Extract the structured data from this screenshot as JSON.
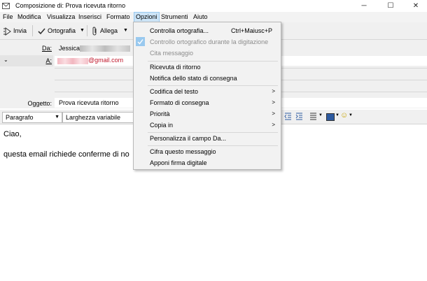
{
  "window": {
    "title": "Composizione di: Prova ricevuta ritorno",
    "min": "─",
    "max": "☐",
    "close": "✕"
  },
  "menubar": {
    "items": [
      {
        "label": "File"
      },
      {
        "label": "Modifica"
      },
      {
        "label": "Visualizza"
      },
      {
        "label": "Inserisci"
      },
      {
        "label": "Formato"
      },
      {
        "label": "Opzioni"
      },
      {
        "label": "Strumenti"
      },
      {
        "label": "Aiuto"
      }
    ]
  },
  "toolbar": {
    "send_label": "Invia",
    "spelling_label": "Ortografia",
    "attach_label": "Allega"
  },
  "header": {
    "from_label": "Da:",
    "from_name": "Jessica",
    "to_label": "A:",
    "to_domain": "@gmail.com",
    "subject_label": "Oggetto:",
    "subject_value": "Prova ricevuta ritorno"
  },
  "format": {
    "paragraph": "Paragrafo",
    "font": "Larghezza variabile"
  },
  "body": {
    "line1": "Ciao,",
    "line2": "questa email richiede conferme di no"
  },
  "options_menu": {
    "items": [
      {
        "label": "Controlla ortografia...",
        "shortcut": "Ctrl+Maiusc+P"
      },
      {
        "label": "Controllo ortografico durante la digitazione"
      },
      {
        "label": "Cita messaggio"
      },
      {
        "label": "Ricevuta di ritorno"
      },
      {
        "label": "Notifica dello stato di consegna"
      },
      {
        "label": "Codifica del testo"
      },
      {
        "label": "Formato di consegna"
      },
      {
        "label": "Priorità"
      },
      {
        "label": "Copia in"
      },
      {
        "label": "Personalizza il campo Da..."
      },
      {
        "label": "Cifra questo messaggio"
      },
      {
        "label": "Apponi firma digitale"
      }
    ],
    "submenu_arrow": ">"
  }
}
